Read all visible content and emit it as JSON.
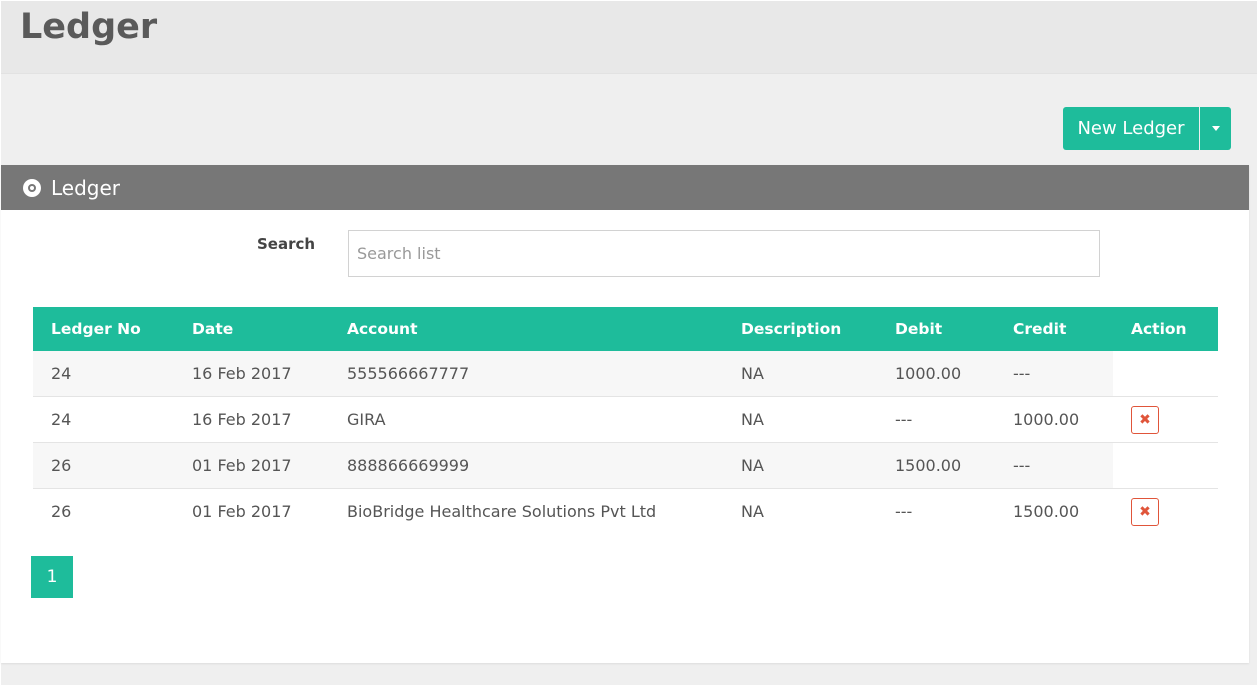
{
  "header": {
    "title": "Ledger"
  },
  "toolbar": {
    "new_label": "New Ledger"
  },
  "panel": {
    "title": "Ledger"
  },
  "search": {
    "label": "Search",
    "placeholder": "Search list",
    "value": ""
  },
  "table": {
    "columns": [
      "Ledger No",
      "Date",
      "Account",
      "Description",
      "Debit",
      "Credit",
      "Action"
    ],
    "rows": [
      {
        "no": "24",
        "date": "16 Feb 2017",
        "account": "555566667777",
        "description": "NA",
        "debit": "1000.00",
        "credit": "---",
        "has_delete": false
      },
      {
        "no": "24",
        "date": "16 Feb 2017",
        "account": "GIRA",
        "description": "NA",
        "debit": "---",
        "credit": "1000.00",
        "has_delete": true
      },
      {
        "no": "26",
        "date": "01 Feb 2017",
        "account": "888866669999",
        "description": "NA",
        "debit": "1500.00",
        "credit": "---",
        "has_delete": false
      },
      {
        "no": "26",
        "date": "01 Feb 2017",
        "account": "BioBridge Healthcare Solutions Pvt Ltd",
        "description": "NA",
        "debit": "---",
        "credit": "1500.00",
        "has_delete": true
      }
    ],
    "delete_icon": "close-icon",
    "delete_glyph": "✖"
  },
  "pagination": {
    "pages": [
      "1"
    ],
    "current": "1"
  },
  "colors": {
    "accent": "#1ebc9b",
    "panel_header": "#777777",
    "danger": "#e0553a"
  }
}
